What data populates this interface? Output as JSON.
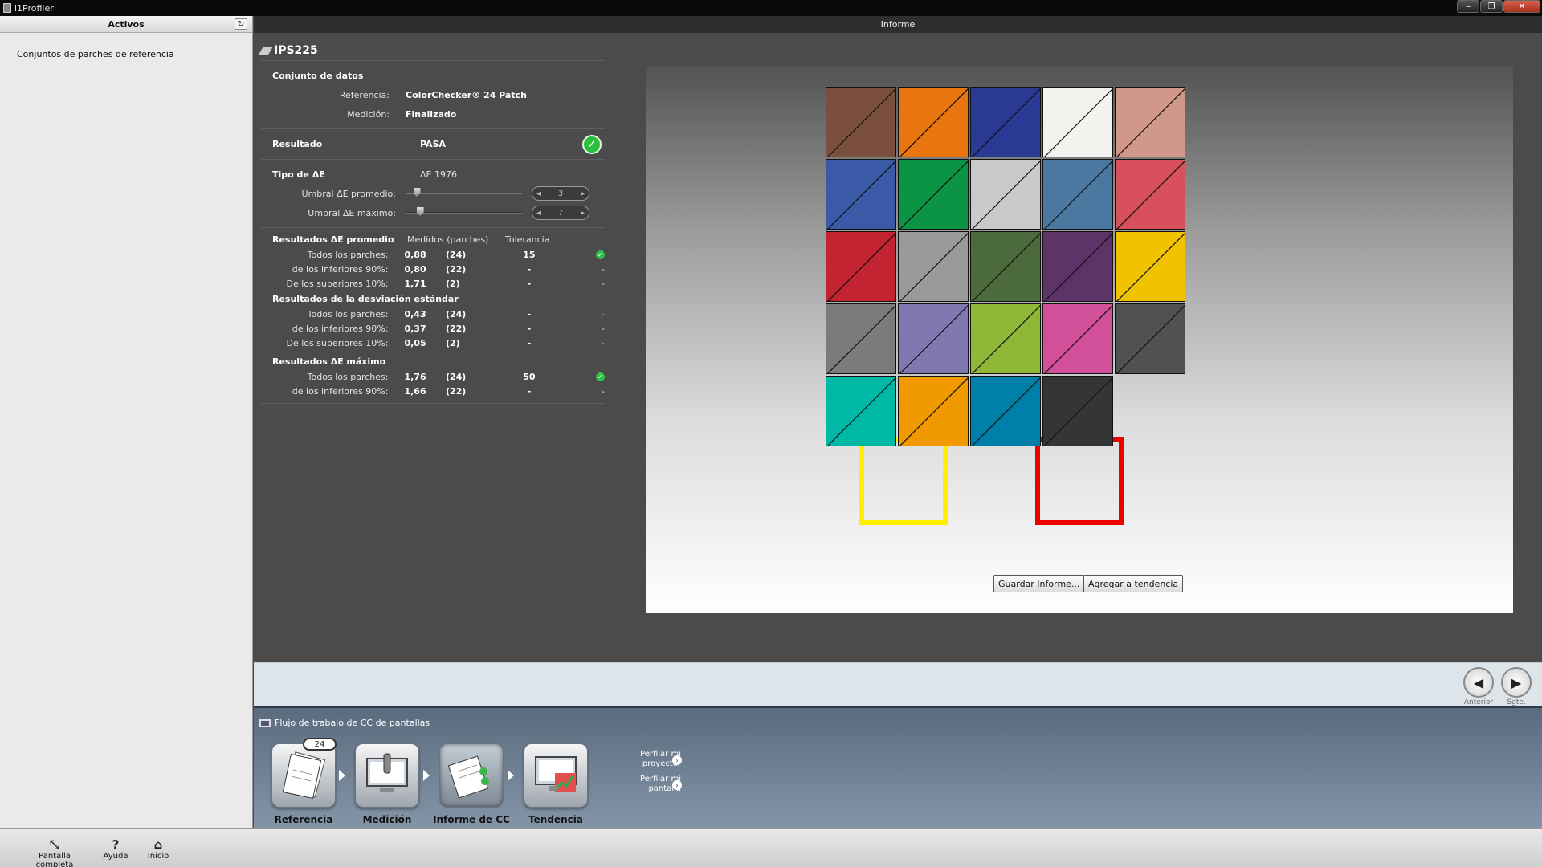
{
  "app": {
    "title": "i1Profiler",
    "window_buttons": [
      "‒",
      "❐",
      "✕"
    ]
  },
  "left_panel": {
    "header": "Activos",
    "refresh_icon": "↻",
    "items": [
      "Conjuntos de parches de referencia"
    ]
  },
  "main": {
    "header": "Informe",
    "device": "IPS225",
    "dataset": {
      "title": "Conjunto de datos",
      "reference_label": "Referencia:",
      "reference_value": "ColorChecker® 24 Patch",
      "measurement_label": "Medición:",
      "measurement_value": "Finalizado"
    },
    "result": {
      "label": "Resultado",
      "value": "PASA",
      "icon": "check-icon"
    },
    "delta_type": {
      "label": "Tipo de ΔE",
      "value": "ΔE 1976",
      "avg_threshold_label": "Umbral ΔE promedio:",
      "avg_threshold_value": "3",
      "avg_threshold_level": 0.07,
      "max_threshold_label": "Umbral ΔE máximo:",
      "max_threshold_value": "7",
      "max_threshold_level": 0.1
    },
    "avg_results": {
      "title": "Resultados ΔE promedio",
      "col_measured": "Medidos (parches)",
      "col_tolerance": "Tolerancia",
      "rows": [
        {
          "label": "Todos los parches:",
          "value": "0,88",
          "count": "(24)",
          "tolerance": "15",
          "ok": "✓"
        },
        {
          "label": "de los inferiores 90%:",
          "value": "0,80",
          "count": "(22)",
          "tolerance": "-",
          "ok": "-"
        },
        {
          "label": "De los superiores 10%:",
          "value": "1,71",
          "count": "(2)",
          "tolerance": "-",
          "ok": "-"
        }
      ]
    },
    "std_results": {
      "title": "Resultados de la desviación estándar",
      "rows": [
        {
          "label": "Todos los parches:",
          "value": "0,43",
          "count": "(24)",
          "tolerance": "-",
          "ok": "-"
        },
        {
          "label": "de los inferiores 90%:",
          "value": "0,37",
          "count": "(22)",
          "tolerance": "-",
          "ok": "-"
        },
        {
          "label": "De los superiores 10%:",
          "value": "0,05",
          "count": "(2)",
          "tolerance": "-",
          "ok": "-"
        }
      ]
    },
    "max_results": {
      "title": "Resultados ΔE máximo",
      "rows": [
        {
          "label": "Todos los parches:",
          "value": "1,76",
          "count": "(24)",
          "tolerance": "50",
          "ok": "✓"
        },
        {
          "label": "de los inferiores 90%:",
          "value": "1,66",
          "count": "(22)",
          "tolerance": "-",
          "ok": "-"
        }
      ]
    },
    "patches": [
      "#7a4f3e",
      "#e87510",
      "#2a3a94",
      "#f4f2ee",
      "#d0978a",
      "#3a5aa8",
      "#0a9444",
      "#c8c9c9",
      "#4a78a0",
      "#d8505c",
      "#c42432",
      "#9a9a9b",
      "#4b6b3c",
      "#5c3468",
      "#f0c200",
      "#7a7b7b",
      "#8078b0",
      "#90b838",
      "#d2509a",
      "#505252",
      "#00b8a6",
      "#f09a00",
      "#0080a8",
      "#343636"
    ],
    "highlight_yellow": "#ffee00",
    "highlight_red": "#ee0000",
    "save_report_button": "Guardar Informe...",
    "add_trend_button": "Agregar a tendencia"
  },
  "nav": {
    "prev_label": "Anterior",
    "next_label": "Sgte."
  },
  "workflow": {
    "title": "Flujo de trabajo de CC de pantallas",
    "badge": "24",
    "steps": [
      "Referencia",
      "Medición",
      "Informe de CC",
      "Tendencia"
    ],
    "side_links": [
      "Perfilar mi proyector",
      "Perfilar mi pantalla"
    ]
  },
  "footer": {
    "fullscreen": "Pantalla completa",
    "help": "Ayuda",
    "home": "Inicio"
  }
}
